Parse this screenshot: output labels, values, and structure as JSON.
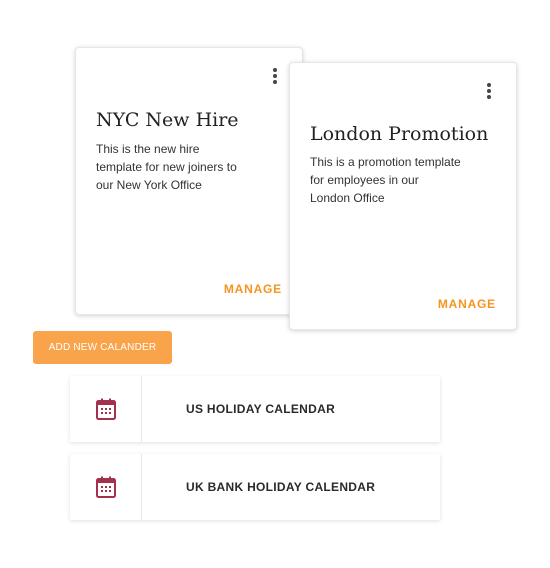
{
  "cards": [
    {
      "title": "NYC New Hire",
      "description": "This is the new hire template for new joiners to our New York Office",
      "action_label": "MANAGE",
      "menu_icon": "more-vertical-icon"
    },
    {
      "title": "London Promotion",
      "description": "This is a promotion template for employees in our London Office",
      "action_label": "MANAGE",
      "menu_icon": "more-vertical-icon"
    }
  ],
  "add_calendar_button": {
    "label": "ADD NEW CALANDER"
  },
  "calendars": [
    {
      "name": "US HOLIDAY CALENDAR",
      "icon": "calendar-icon"
    },
    {
      "name": "UK BANK HOLIDAY CALENDAR",
      "icon": "calendar-icon"
    }
  ],
  "colors": {
    "accent": "#f7941d",
    "button_bg": "#f9a34a",
    "calendar_icon": "#a3314e"
  }
}
